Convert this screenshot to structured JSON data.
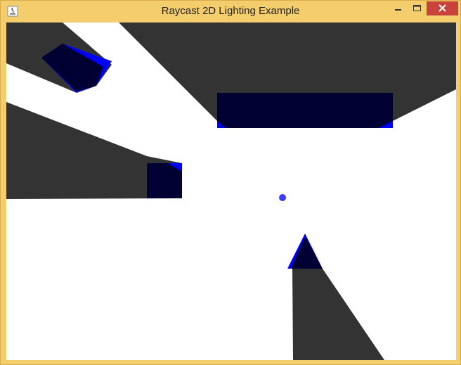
{
  "window": {
    "title": "Raycast 2D Lighting Example",
    "app_icon": "java-icon",
    "controls": {
      "minimize_icon": "minimize-icon",
      "maximize_icon": "maximize-icon",
      "close_icon": "close-icon"
    }
  },
  "colors": {
    "title_bar": "#f4cd6c",
    "lit_area": "#ffffff",
    "shadow": "#333333",
    "obstacle_fill": "#000033",
    "obstacle_edge": "#0000ff",
    "light_source": "#3b3bff",
    "close_button": "#c7433b"
  }
}
